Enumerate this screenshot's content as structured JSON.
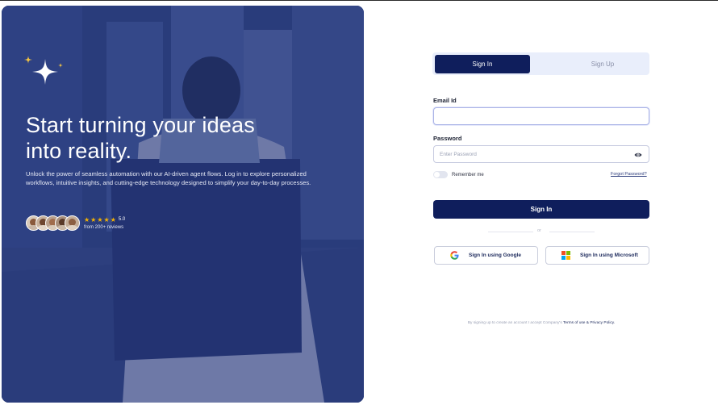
{
  "hero": {
    "title": "Start turning your ideas into reality.",
    "subtitle": "Unlock the power of seamless automation with our AI-driven agent flows. Log in to explore personalized workflows, intuitive insights, and cutting-edge technology designed to simplify your day-to-day processes.",
    "rating_value": "5.0",
    "reviews_text": "from 200+ reviews",
    "stars": 5,
    "avatar_count": 5
  },
  "auth": {
    "tabs": [
      {
        "label": "Sign In",
        "active": true
      },
      {
        "label": "Sign Up",
        "active": false
      }
    ],
    "email": {
      "label": "Email Id",
      "value": "",
      "placeholder": ""
    },
    "password": {
      "label": "Password",
      "placeholder": "Enter Password"
    },
    "remember_label": "Remember me",
    "forgot_label": "Forgot Password?",
    "submit_label": "Sign In",
    "divider_text": "or",
    "google_label": "Sign In using Google",
    "microsoft_label": "Sign In using Microsoft",
    "terms_prefix": "By signing up to create an account I accept Company's",
    "terms_link": "Terms of use & Privacy Policy."
  },
  "colors": {
    "primary": "#0f1e5c",
    "tab_bg": "#e9eefb",
    "hero_overlay": "#223478",
    "star": "#f5b301"
  },
  "icons": [
    "sparkle-icon",
    "star-icon",
    "eye-icon",
    "google-icon",
    "microsoft-icon"
  ]
}
